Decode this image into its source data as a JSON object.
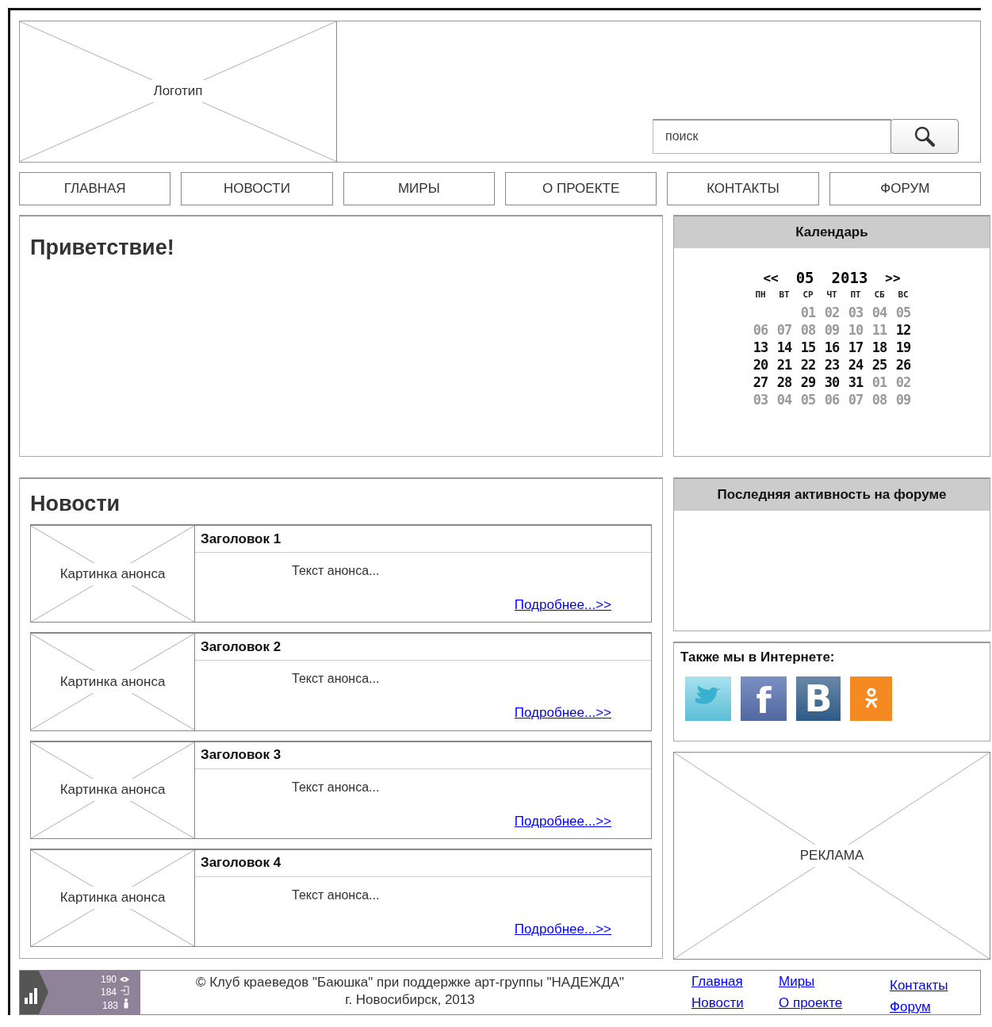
{
  "header": {
    "logo": "Логотип",
    "search": {
      "placeholder": "поиск"
    }
  },
  "nav": [
    {
      "label": "ГЛАВНАЯ"
    },
    {
      "label": "НОВОСТИ"
    },
    {
      "label": "МИРЫ"
    },
    {
      "label": "О ПРОЕКТЕ"
    },
    {
      "label": "КОНТАКТЫ"
    },
    {
      "label": "ФОРУМ"
    }
  ],
  "welcome": {
    "title": "Приветствие!"
  },
  "calendar": {
    "title": "Календарь",
    "prev": "<<",
    "month": "05",
    "year": "2013",
    "next": ">>",
    "weekdays": [
      "ПН",
      "ВТ",
      "СР",
      "ЧТ",
      "ПТ",
      "СБ",
      "ВС"
    ],
    "weeks": [
      [
        {
          "day": "01",
          "muted": true
        },
        {
          "day": "02",
          "muted": true
        },
        {
          "day": "03",
          "muted": true
        },
        {
          "day": "04",
          "muted": true
        },
        {
          "day": "05",
          "muted": true
        }
      ],
      [
        {
          "day": "06",
          "muted": true
        },
        {
          "day": "07",
          "muted": true
        },
        {
          "day": "08",
          "muted": true
        },
        {
          "day": "09",
          "muted": true
        },
        {
          "day": "10",
          "muted": true
        },
        {
          "day": "11",
          "muted": true
        },
        {
          "day": "12",
          "muted": false
        }
      ],
      [
        {
          "day": "13",
          "muted": false
        },
        {
          "day": "14",
          "muted": false
        },
        {
          "day": "15",
          "muted": false
        },
        {
          "day": "16",
          "muted": false
        },
        {
          "day": "17",
          "muted": false
        },
        {
          "day": "18",
          "muted": false
        },
        {
          "day": "19",
          "muted": false
        }
      ],
      [
        {
          "day": "20",
          "muted": false
        },
        {
          "day": "21",
          "muted": false
        },
        {
          "day": "22",
          "muted": false
        },
        {
          "day": "23",
          "muted": false
        },
        {
          "day": "24",
          "muted": false
        },
        {
          "day": "25",
          "muted": false
        },
        {
          "day": "26",
          "muted": false
        }
      ],
      [
        {
          "day": "27",
          "muted": false
        },
        {
          "day": "28",
          "muted": false
        },
        {
          "day": "29",
          "muted": false
        },
        {
          "day": "30",
          "muted": false
        },
        {
          "day": "31",
          "muted": false
        },
        {
          "day": "01",
          "muted": true
        },
        {
          "day": "02",
          "muted": true
        }
      ],
      [
        {
          "day": "03",
          "muted": true
        },
        {
          "day": "04",
          "muted": true
        },
        {
          "day": "05",
          "muted": true
        },
        {
          "day": "06",
          "muted": true
        },
        {
          "day": "07",
          "muted": true
        },
        {
          "day": "08",
          "muted": true
        },
        {
          "day": "09",
          "muted": true
        }
      ]
    ]
  },
  "news": {
    "title": "Новости",
    "items": [
      {
        "image": "Картинка анонса",
        "title": "Заголовок 1",
        "text": "Текст анонса...",
        "link": "Подробнее...>>"
      },
      {
        "image": "Картинка анонса",
        "title": "Заголовок 2",
        "text": "Текст анонса...",
        "link": "Подробнее...>>"
      },
      {
        "image": "Картинка анонса",
        "title": "Заголовок 3",
        "text": "Текст анонса...",
        "link": "Подробнее...>>"
      },
      {
        "image": "Картинка анонса",
        "title": "Заголовок 4",
        "text": "Текст анонса...",
        "link": "Подробнее...>>"
      }
    ]
  },
  "forum": {
    "title": "Последняя активность на форуме"
  },
  "social": {
    "title": "Также мы в Интернете:",
    "links": [
      {
        "kind": "twitter"
      },
      {
        "kind": "facebook",
        "glyph": "f"
      },
      {
        "kind": "vk",
        "glyph": "B"
      },
      {
        "kind": "ok"
      }
    ]
  },
  "ad": {
    "label": "РЕКЛАМА"
  },
  "footer": {
    "counter": [
      {
        "kind": "views",
        "value": "190"
      },
      {
        "kind": "visits",
        "value": "184"
      },
      {
        "kind": "visitors",
        "value": "183"
      }
    ],
    "copyright": [
      "© Клуб краеведов \"Баюшка\" при поддержке арт-группы \"НАДЕЖДА\"",
      "г. Новосибирск, 2013"
    ],
    "link_columns": [
      [
        "Главная",
        "Новости"
      ],
      [
        "Миры",
        "О проекте"
      ],
      [
        "Контакты",
        "Форум"
      ]
    ]
  }
}
